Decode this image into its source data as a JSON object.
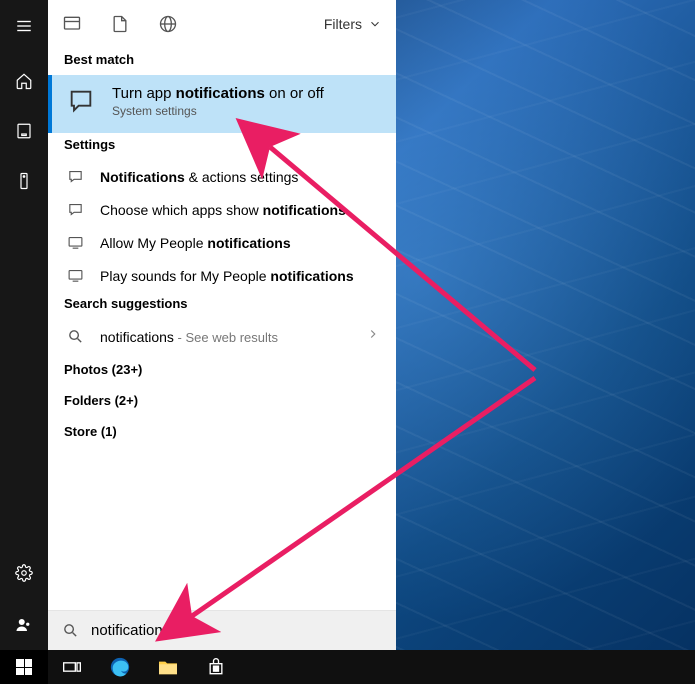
{
  "sidebar": {
    "items": [
      "menu",
      "home",
      "app",
      "remote",
      "settings",
      "user"
    ]
  },
  "panel": {
    "top": {
      "filters_label": "Filters"
    },
    "best_match": {
      "header": "Best match",
      "title_pre": "Turn app ",
      "title_bold": "notifications",
      "title_post": " on or off",
      "subtitle": "System settings"
    },
    "settings": {
      "header": "Settings",
      "rows": [
        {
          "pre": "",
          "bold": "Notifications",
          "post": " & actions settings",
          "icon": "message"
        },
        {
          "pre": "Choose which apps show ",
          "bold": "notifications",
          "post": "",
          "icon": "message"
        },
        {
          "pre": "Allow My People ",
          "bold": "notifications",
          "post": "",
          "icon": "display"
        },
        {
          "pre": "Play sounds for My People ",
          "bold": "notifications",
          "post": "",
          "icon": "display"
        }
      ]
    },
    "suggestions": {
      "header": "Search suggestions",
      "query": "notifications",
      "hint": " - See web results"
    },
    "extras": {
      "photos": "Photos (23+)",
      "folders": "Folders (2+)",
      "store": "Store (1)"
    }
  },
  "search": {
    "value": "notifications"
  },
  "taskbar": {
    "items": [
      "start",
      "taskview",
      "edge",
      "explorer",
      "store"
    ]
  }
}
